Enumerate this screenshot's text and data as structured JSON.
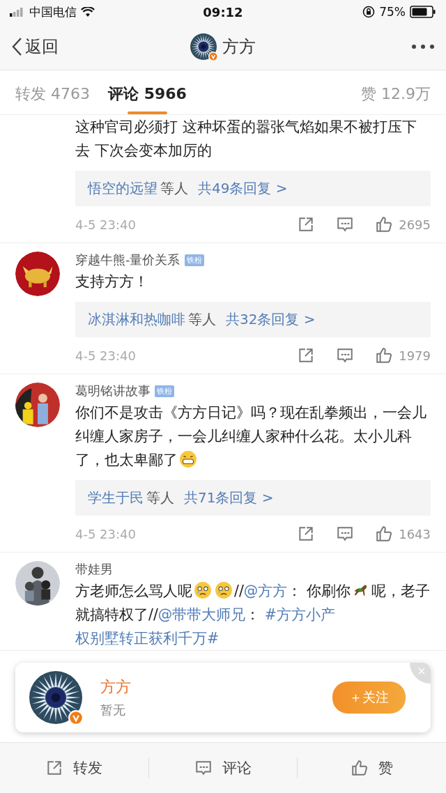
{
  "status_bar": {
    "carrier": "中国电信",
    "time": "09:12",
    "battery": "75%"
  },
  "nav": {
    "back": "返回",
    "title": "方方",
    "verified": true
  },
  "tabs": [
    {
      "label": "转发 4763",
      "selected": false
    },
    {
      "label": "评论 5966",
      "selected": true
    },
    {
      "label": "赞 12.9万",
      "selected": false
    }
  ],
  "comments": [
    {
      "segments": [
        {
          "kind": "plain",
          "text": "这种官司必须打 这种坏蛋的嚣张气焰如果不被打压下去 下次会变本加厉的"
        }
      ],
      "reply": {
        "names": "悟空的远望",
        "suffix": "等人",
        "count": "共49条回复 >"
      },
      "time": "4-5 23:40",
      "likes": "2695"
    },
    {
      "name": "穿越牛熊-量价关系",
      "badge": "铁粉",
      "segments": [
        {
          "kind": "plain",
          "text": "支持方方！"
        }
      ],
      "reply": {
        "names": "冰淇淋和热咖啡",
        "suffix": "等人",
        "count": "共32条回复 >"
      },
      "time": "4-5 23:40",
      "likes": "1979"
    },
    {
      "name": "葛明铭讲故事",
      "badge": "铁粉",
      "segments": [
        {
          "kind": "plain",
          "text": "你们不是攻击《方方日记》吗？现在乱拳频出，一会儿纠缠人家房子，一会儿纠缠人家种什么花。太小儿科了，也太卑鄙了"
        },
        {
          "kind": "grin"
        }
      ],
      "reply": {
        "names": "学生于民",
        "suffix": "等人",
        "count": "共71条回复 >"
      },
      "time": "4-5 23:40",
      "likes": "1643"
    },
    {
      "name": "带娃男",
      "segments": [
        {
          "kind": "plain",
          "text": "方老师怎么骂人呢"
        },
        {
          "kind": "cry"
        },
        {
          "kind": "cry"
        },
        {
          "kind": "plain",
          "text": "//"
        },
        {
          "kind": "link",
          "text": "@方方"
        },
        {
          "kind": "plain",
          "text": "： 你刷你"
        },
        {
          "kind": "horse"
        },
        {
          "kind": "plain",
          "text": "呢，老子就搞特权了//"
        },
        {
          "kind": "link",
          "text": "@带带大师兄"
        },
        {
          "kind": "plain",
          "text": "： "
        },
        {
          "kind": "link",
          "text": "#方方小产"
        },
        {
          "kind": "link",
          "text": "权别墅转正获利千万#"
        }
      ]
    }
  ],
  "follow_card": {
    "name": "方方",
    "bio": "暂无",
    "verified": true,
    "button": "＋关注"
  },
  "bottom_bar": [
    {
      "kind": "share",
      "label": "转发"
    },
    {
      "kind": "comment",
      "label": "评论"
    },
    {
      "kind": "like",
      "label": "赞"
    }
  ]
}
